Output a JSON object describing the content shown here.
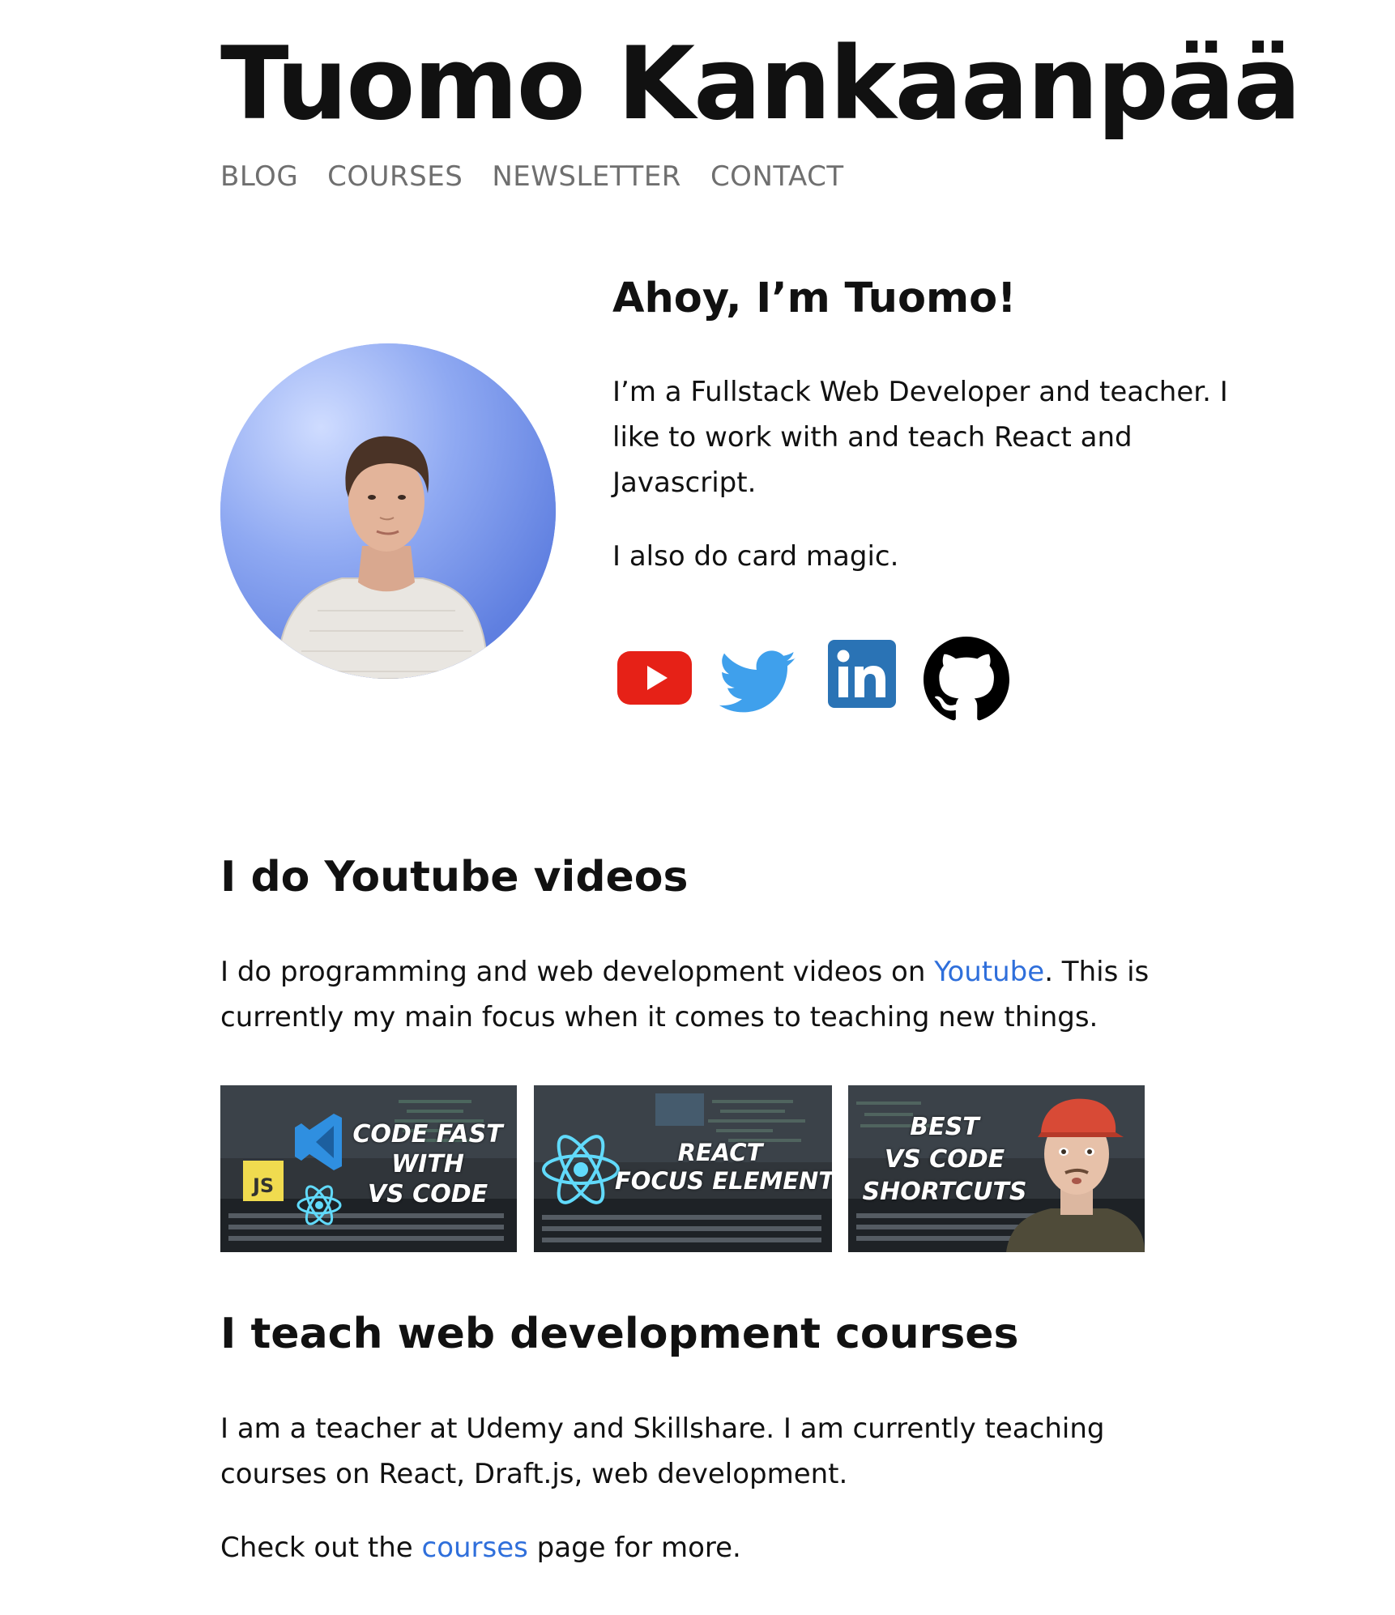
{
  "header": {
    "site_title": "Tuomo Kankaanpää",
    "nav": [
      "BLOG",
      "COURSES",
      "NEWSLETTER",
      "CONTACT"
    ]
  },
  "intro": {
    "heading": "Ahoy, I’m Tuomo!",
    "text1": "I’m a Fullstack Web Developer and teacher. I like to work with and teach React and Javascript.",
    "text2": "I also do card magic."
  },
  "socials": {
    "icons": [
      "youtube-icon",
      "twitter-icon",
      "linkedin-icon",
      "github-icon"
    ],
    "colors": {
      "youtube": "#e62117",
      "twitter": "#3fa0ec",
      "linkedin": "#2a73b5",
      "github": "#000000"
    }
  },
  "youtube_section": {
    "heading": "I do Youtube videos",
    "text_before": "I do programming and web development videos on ",
    "link": "Youtube",
    "text_after": ". This is currently my main focus when it comes to teaching new things.",
    "videos": [
      {
        "lines": [
          "CODE FAST",
          "WITH",
          "VS CODE"
        ]
      },
      {
        "lines": [
          "REACT",
          "FOCUS ELEMENT"
        ]
      },
      {
        "lines": [
          "BEST",
          "VS CODE",
          "SHORTCUTS"
        ]
      }
    ]
  },
  "courses_section": {
    "heading": "I teach web development courses",
    "text1": "I am a teacher at Udemy and Skillshare. I am currently teaching courses on React, Draft.js, web development.",
    "text2_before": "Check out the ",
    "text2_link": "courses",
    "text2_after": " page for more."
  },
  "colors": {
    "link": "#2f6fdb",
    "nav": "#6f6f6f",
    "text": "#111111"
  }
}
